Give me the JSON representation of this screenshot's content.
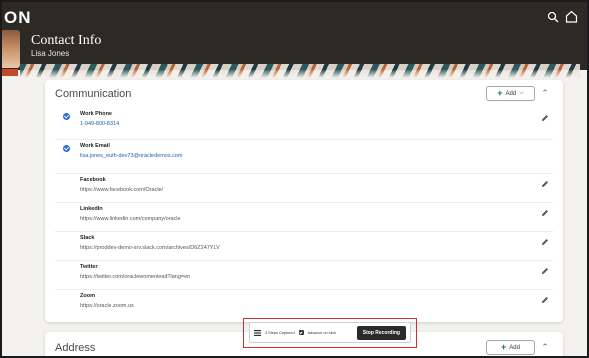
{
  "header": {
    "brand": "ON",
    "title": "Contact Info",
    "subtitle": "Lisa Jones"
  },
  "communication": {
    "title": "Communication",
    "add_label": "Add",
    "rows": [
      {
        "label": "Work Phone",
        "value": "1-949-800-8314",
        "link": true,
        "checked": true
      },
      {
        "label": "Work Email",
        "value": "lisa.jones_euth-dev73@oracledemos.com",
        "link": true,
        "checked": true
      },
      {
        "label": "Facebook",
        "value": "https://www.facebook.com/Oracle/",
        "link": false,
        "checked": false
      },
      {
        "label": "LinkedIn",
        "value": "https://www.linkedin.com/company/oracle",
        "link": false,
        "checked": false
      },
      {
        "label": "Slack",
        "value": "https://proddev-demo-srv.slack.com/archives/D6Z247YLV",
        "link": false,
        "checked": false
      },
      {
        "label": "Twitter",
        "value": "https://twitter.com/oraclewomenlead?lang=en",
        "link": false,
        "checked": false
      },
      {
        "label": "Zoom",
        "value": "https://oracle.zoom.us",
        "link": false,
        "checked": false
      }
    ]
  },
  "address": {
    "title": "Address",
    "add_label": "Add"
  },
  "recorder": {
    "steps_text": "3 Steps Captured",
    "advance_label": "Advance on click",
    "stop_label": "Stop Recording"
  },
  "colors": {
    "header_bg": "#2d2a26",
    "link": "#1f5fa8",
    "check": "#2a6fd6",
    "recorder_outline": "#d0312d"
  }
}
